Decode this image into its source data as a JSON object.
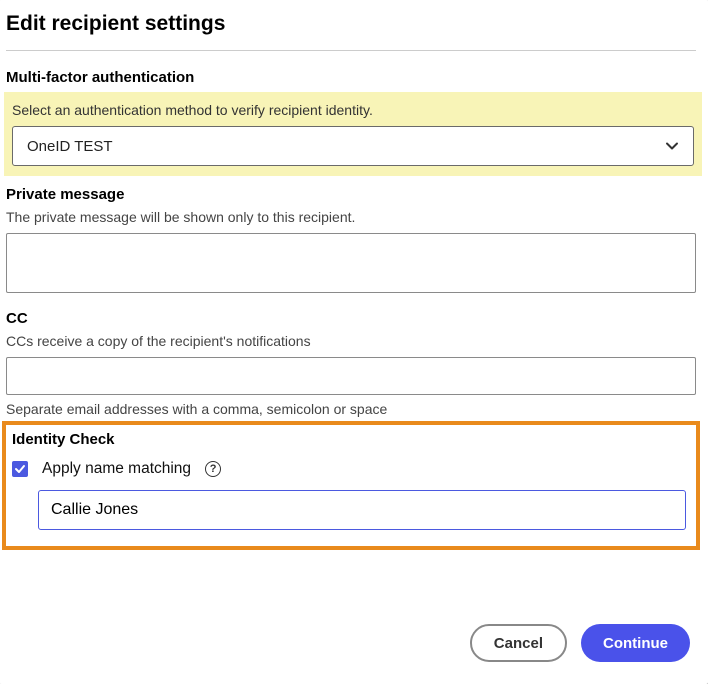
{
  "title": "Edit recipient settings",
  "mfa": {
    "heading": "Multi-factor authentication",
    "description": "Select an authentication method to verify recipient identity.",
    "selected": "OneID TEST"
  },
  "privateMessage": {
    "heading": "Private message",
    "description": "The private message will be shown only to this recipient.",
    "value": ""
  },
  "cc": {
    "heading": "CC",
    "description": "CCs receive a copy of the recipient's notifications",
    "value": "",
    "hint": "Separate email addresses with a comma, semicolon or space"
  },
  "identityCheck": {
    "heading": "Identity Check",
    "checkboxLabel": "Apply name matching",
    "checked": true,
    "nameValue": "Callie Jones"
  },
  "footer": {
    "cancel": "Cancel",
    "continue": "Continue"
  }
}
